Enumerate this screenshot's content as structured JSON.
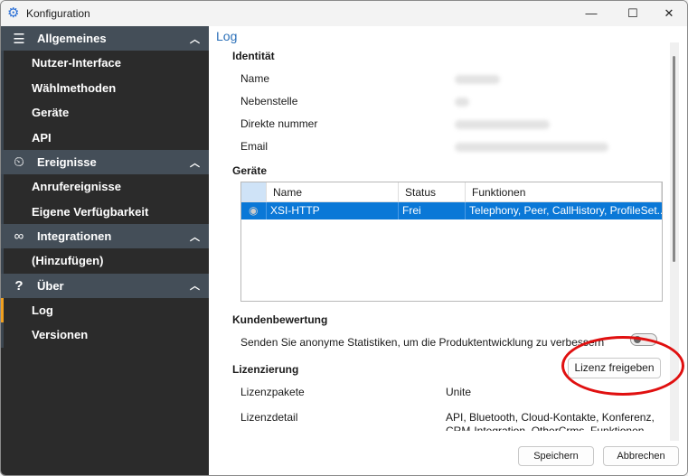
{
  "window": {
    "title": "Konfiguration",
    "minimize": "—",
    "maximize": "☐",
    "close": "✕"
  },
  "sidebar": {
    "sections": [
      {
        "label": "Allgemeines",
        "icon": "menu-icon",
        "items": [
          "Nutzer-Interface",
          "Wählmethoden",
          "Geräte",
          "API"
        ]
      },
      {
        "label": "Ereignisse",
        "icon": "events-icon",
        "items": [
          "Anrufereignisse",
          "Eigene Verfügbarkeit"
        ]
      },
      {
        "label": "Integrationen",
        "icon": "link-icon",
        "items": [
          "(Hinzufügen)"
        ]
      },
      {
        "label": "Über",
        "icon": "question-icon",
        "items": [
          "Log",
          "Versionen"
        ]
      }
    ],
    "active_item": "Log"
  },
  "main": {
    "title": "Log",
    "identity": {
      "heading": "Identität",
      "fields": [
        "Name",
        "Nebenstelle",
        "Direkte nummer",
        "Email"
      ]
    },
    "devices": {
      "heading": "Geräte",
      "columns": [
        "Name",
        "Status",
        "Funktionen"
      ],
      "rows": [
        {
          "name": "XSI-HTTP",
          "status": "Frei",
          "functions": "Telephony, Peer, CallHistory, ProfileSet..."
        }
      ]
    },
    "feedback": {
      "heading": "Kundenbewertung",
      "text": "Senden Sie anonyme Statistiken, um die Produktentwicklung zu verbessern",
      "enabled": false
    },
    "licensing": {
      "heading": "Lizenzierung",
      "release_button": "Lizenz freigeben",
      "packages_label": "Lizenzpakete",
      "packages_value": "Unite",
      "detail_label": "Lizenzdetail",
      "detail_value": "API, Bluetooth, Cloud-Kontakte, Konferenz, CRM-Integration, OtherCrms, Funktionen"
    }
  },
  "footer": {
    "save": "Speichern",
    "cancel": "Abbrechen"
  },
  "colors": {
    "accent": "#0a78d7",
    "sidebar_header": "#444e58",
    "sidebar_bg": "#2b2b2b",
    "active_marker": "#f0a020",
    "annotation": "#e01010"
  }
}
